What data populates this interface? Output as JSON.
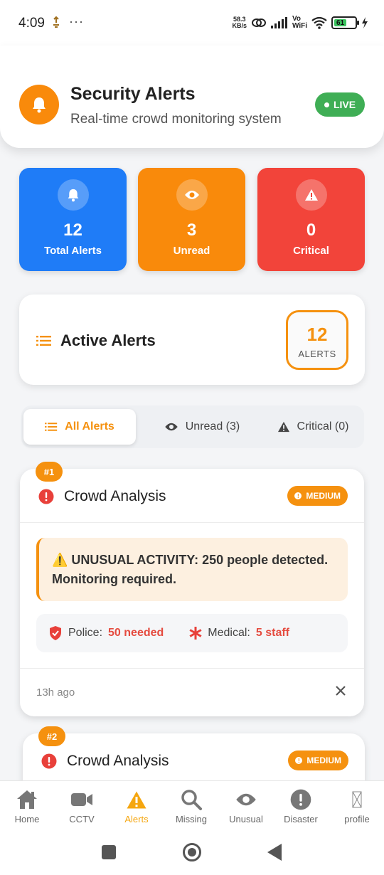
{
  "status_bar": {
    "time": "4:09",
    "dots": "···",
    "speed_value": "58.3",
    "speed_unit": "KB/s",
    "volte": "Vo",
    "wifi_label": "WiFi",
    "battery": "61"
  },
  "header": {
    "title": "Security Alerts",
    "subtitle": "Real-time crowd monitoring system",
    "live_label": "LIVE",
    "icon": "bell-icon"
  },
  "stats": [
    {
      "icon": "bell-icon",
      "value": "12",
      "label": "Total Alerts",
      "color": "#1f7cf7"
    },
    {
      "icon": "eye-icon",
      "value": "3",
      "label": "Unread",
      "color": "#f98a0b"
    },
    {
      "icon": "warning-icon",
      "value": "0",
      "label": "Critical",
      "color": "#f2443a"
    }
  ],
  "active_alerts": {
    "title": "Active Alerts",
    "count": "12",
    "count_label": "ALERTS"
  },
  "tabs": [
    {
      "label": "All Alerts",
      "icon": "list-icon",
      "active": true
    },
    {
      "label": "Unread (3)",
      "icon": "eye-icon",
      "active": false
    },
    {
      "label": "Critical (0)",
      "icon": "warning-icon",
      "active": false
    }
  ],
  "alerts": [
    {
      "number": "#1",
      "title": "Crowd Analysis",
      "severity": "MEDIUM",
      "message": "⚠️ UNUSUAL ACTIVITY: 250 people detected. Monitoring required.",
      "police_label": "Police:",
      "police_value": "50 needed",
      "medical_label": "Medical:",
      "medical_value": "5 staff",
      "time": "13h ago"
    },
    {
      "number": "#2",
      "title": "Crowd Analysis",
      "severity": "MEDIUM"
    }
  ],
  "bottom_nav": [
    {
      "label": "Home",
      "icon": "home-icon"
    },
    {
      "label": "CCTV",
      "icon": "camera-icon"
    },
    {
      "label": "Alerts",
      "icon": "warning-icon",
      "active": true
    },
    {
      "label": "Missing",
      "icon": "search-icon"
    },
    {
      "label": "Unusual",
      "icon": "eye-icon"
    },
    {
      "label": "Disaster",
      "icon": "exclamation-icon"
    },
    {
      "label": "profile",
      "icon": "broken-image-icon"
    }
  ],
  "colors": {
    "accent": "#f5910f",
    "live": "#3fae55",
    "danger": "#e54b3f"
  }
}
